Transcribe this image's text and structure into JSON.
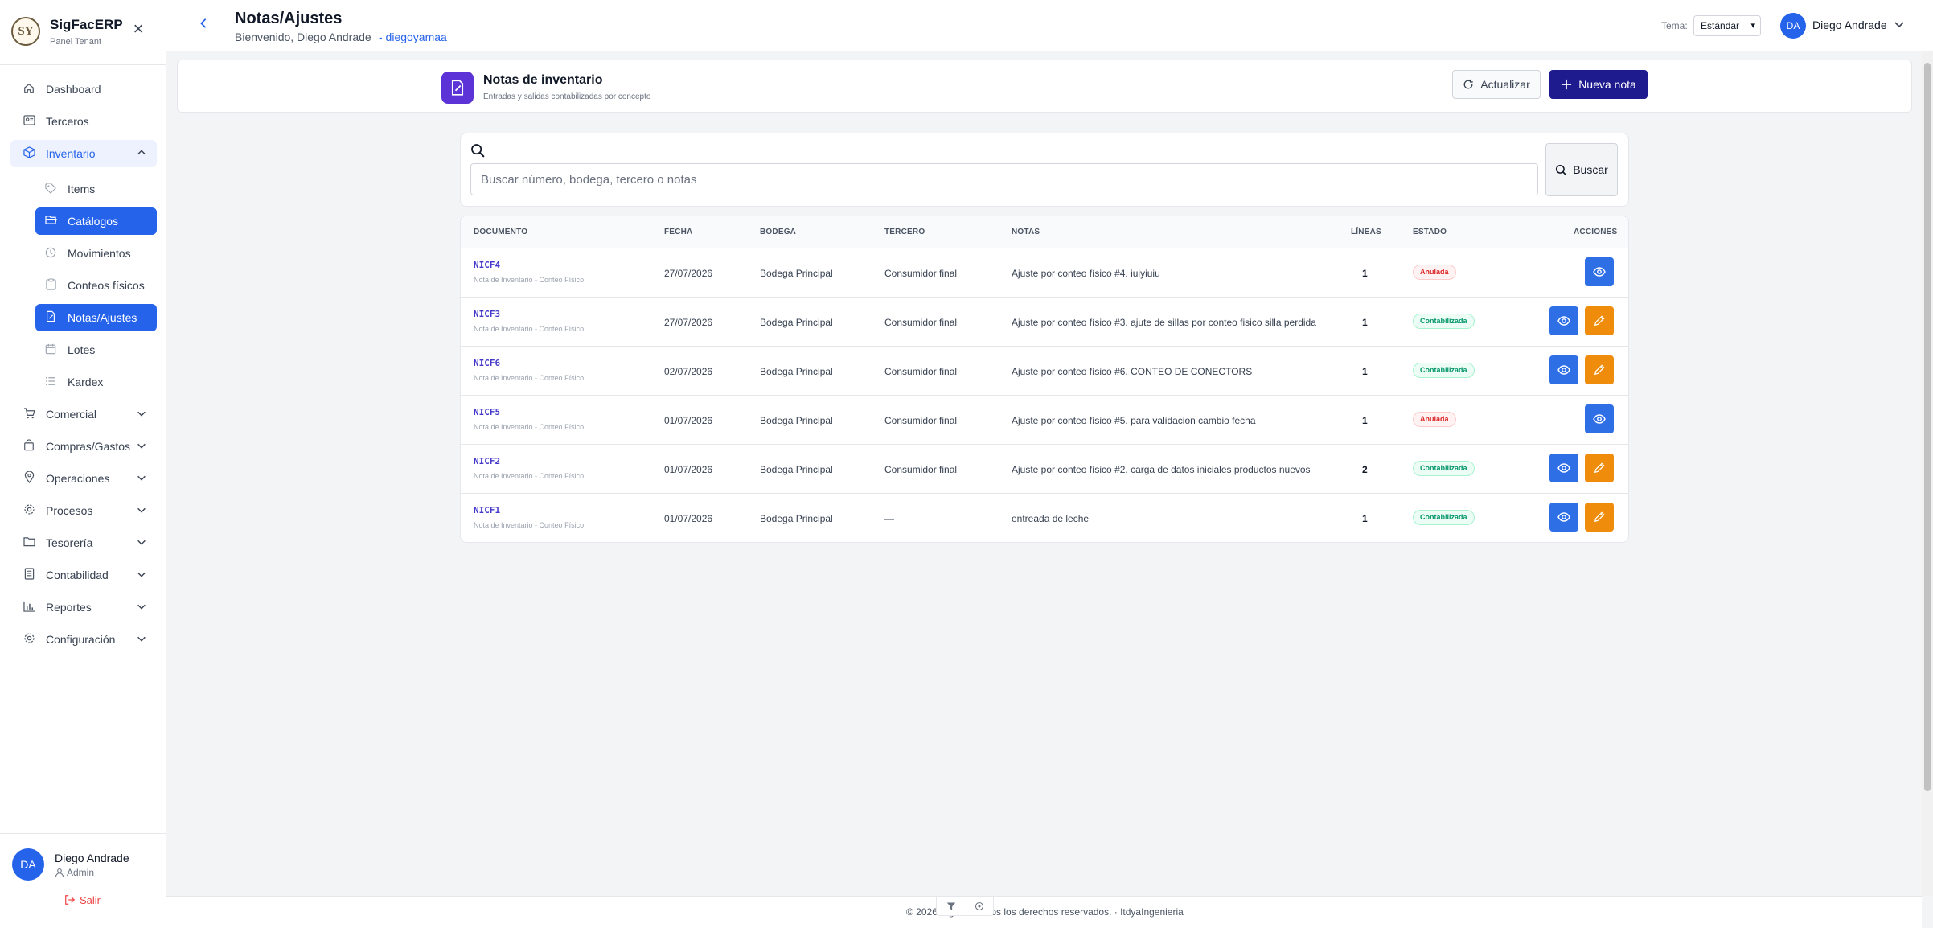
{
  "brand": {
    "name": "SigFacERP",
    "subtitle": "Panel Tenant",
    "logo_text": "SY"
  },
  "sidebar": {
    "items": [
      {
        "label": "Dashboard",
        "icon": "home-icon"
      },
      {
        "label": "Terceros",
        "icon": "id-card-icon"
      },
      {
        "label": "Inventario",
        "icon": "box-icon",
        "open": true
      },
      {
        "label": "Comercial",
        "icon": "cart-icon"
      },
      {
        "label": "Compras/Gastos",
        "icon": "bag-icon"
      },
      {
        "label": "Operaciones",
        "icon": "pin-icon"
      },
      {
        "label": "Procesos",
        "icon": "gear-icon"
      },
      {
        "label": "Tesorería",
        "icon": "folder-icon"
      },
      {
        "label": "Contabilidad",
        "icon": "ledger-icon"
      },
      {
        "label": "Reportes",
        "icon": "bar-chart-icon"
      },
      {
        "label": "Configuración",
        "icon": "settings-icon"
      }
    ],
    "inventario_sub": [
      {
        "label": "Items"
      },
      {
        "label": "Catálogos"
      },
      {
        "label": "Movimientos"
      },
      {
        "label": "Conteos físicos"
      },
      {
        "label": "Notas/Ajustes"
      },
      {
        "label": "Lotes"
      },
      {
        "label": "Kardex"
      }
    ]
  },
  "user": {
    "initials": "DA",
    "name": "Diego Andrade",
    "role": "Admin",
    "logout": "Salir"
  },
  "header": {
    "title": "Notas/Ajustes",
    "welcome": "Bienvenido, Diego Andrade",
    "tenant": "- diegoyamaa",
    "theme_label": "Tema:",
    "theme_value": "Estándar",
    "user_initials": "DA",
    "user_name": "Diego Andrade"
  },
  "page_bar": {
    "title": "Notas de inventario",
    "subtitle": "Entradas y salidas contabilizadas por concepto",
    "refresh_label": "Actualizar",
    "new_label": "Nueva nota"
  },
  "search": {
    "placeholder": "Buscar número, bodega, tercero o notas",
    "button_label": "Buscar"
  },
  "table": {
    "columns": [
      "Documento",
      "Fecha",
      "Bodega",
      "Tercero",
      "Notas",
      "Líneas",
      "Estado",
      "Acciones"
    ],
    "rows": [
      {
        "doc": "NICF4",
        "doc_type": "Nota de Inventario - Conteo Físico",
        "fecha": "27/07/2026",
        "bodega": "Bodega Principal",
        "tercero": "Consumidor final",
        "notas": "Ajuste por conteo físico #4. iuiyiuiu",
        "lineas": "1",
        "estado": "Anulada"
      },
      {
        "doc": "NICF3",
        "doc_type": "Nota de Inventario - Conteo Físico",
        "fecha": "27/07/2026",
        "bodega": "Bodega Principal",
        "tercero": "Consumidor final",
        "notas": "Ajuste por conteo físico #3. ajute de sillas por conteo fisico silla perdida",
        "lineas": "1",
        "estado": "Contabilizada"
      },
      {
        "doc": "NICF6",
        "doc_type": "Nota de Inventario - Conteo Físico",
        "fecha": "02/07/2026",
        "bodega": "Bodega Principal",
        "tercero": "Consumidor final",
        "notas": "Ajuste por conteo físico #6. CONTEO DE CONECTORS",
        "lineas": "1",
        "estado": "Contabilizada"
      },
      {
        "doc": "NICF5",
        "doc_type": "Nota de Inventario - Conteo Físico",
        "fecha": "01/07/2026",
        "bodega": "Bodega Principal",
        "tercero": "Consumidor final",
        "notas": "Ajuste por conteo físico #5. para validacion cambio fecha",
        "lineas": "1",
        "estado": "Anulada"
      },
      {
        "doc": "NICF2",
        "doc_type": "Nota de Inventario - Conteo Físico",
        "fecha": "01/07/2026",
        "bodega": "Bodega Principal",
        "tercero": "Consumidor final",
        "notas": "Ajuste por conteo físico #2. carga de datos iniciales productos nuevos",
        "lineas": "2",
        "estado": "Contabilizada"
      },
      {
        "doc": "NICF1",
        "doc_type": "Nota de Inventario - Conteo Físico",
        "fecha": "01/07/2026",
        "bodega": "Bodega Principal",
        "tercero": "—",
        "notas": "entreada de leche",
        "lineas": "1",
        "estado": "Contabilizada"
      }
    ]
  },
  "footer": {
    "text": "© 2026 SigFac. Todos los derechos reservados. · ItdyaIngenieria"
  },
  "colors": {
    "primary": "#2563eb",
    "brand_dark": "#1e1b8f",
    "accent_purple": "#5b33d6",
    "edit_orange": "#f08c0c",
    "danger": "#dc2626",
    "success": "#059669"
  }
}
